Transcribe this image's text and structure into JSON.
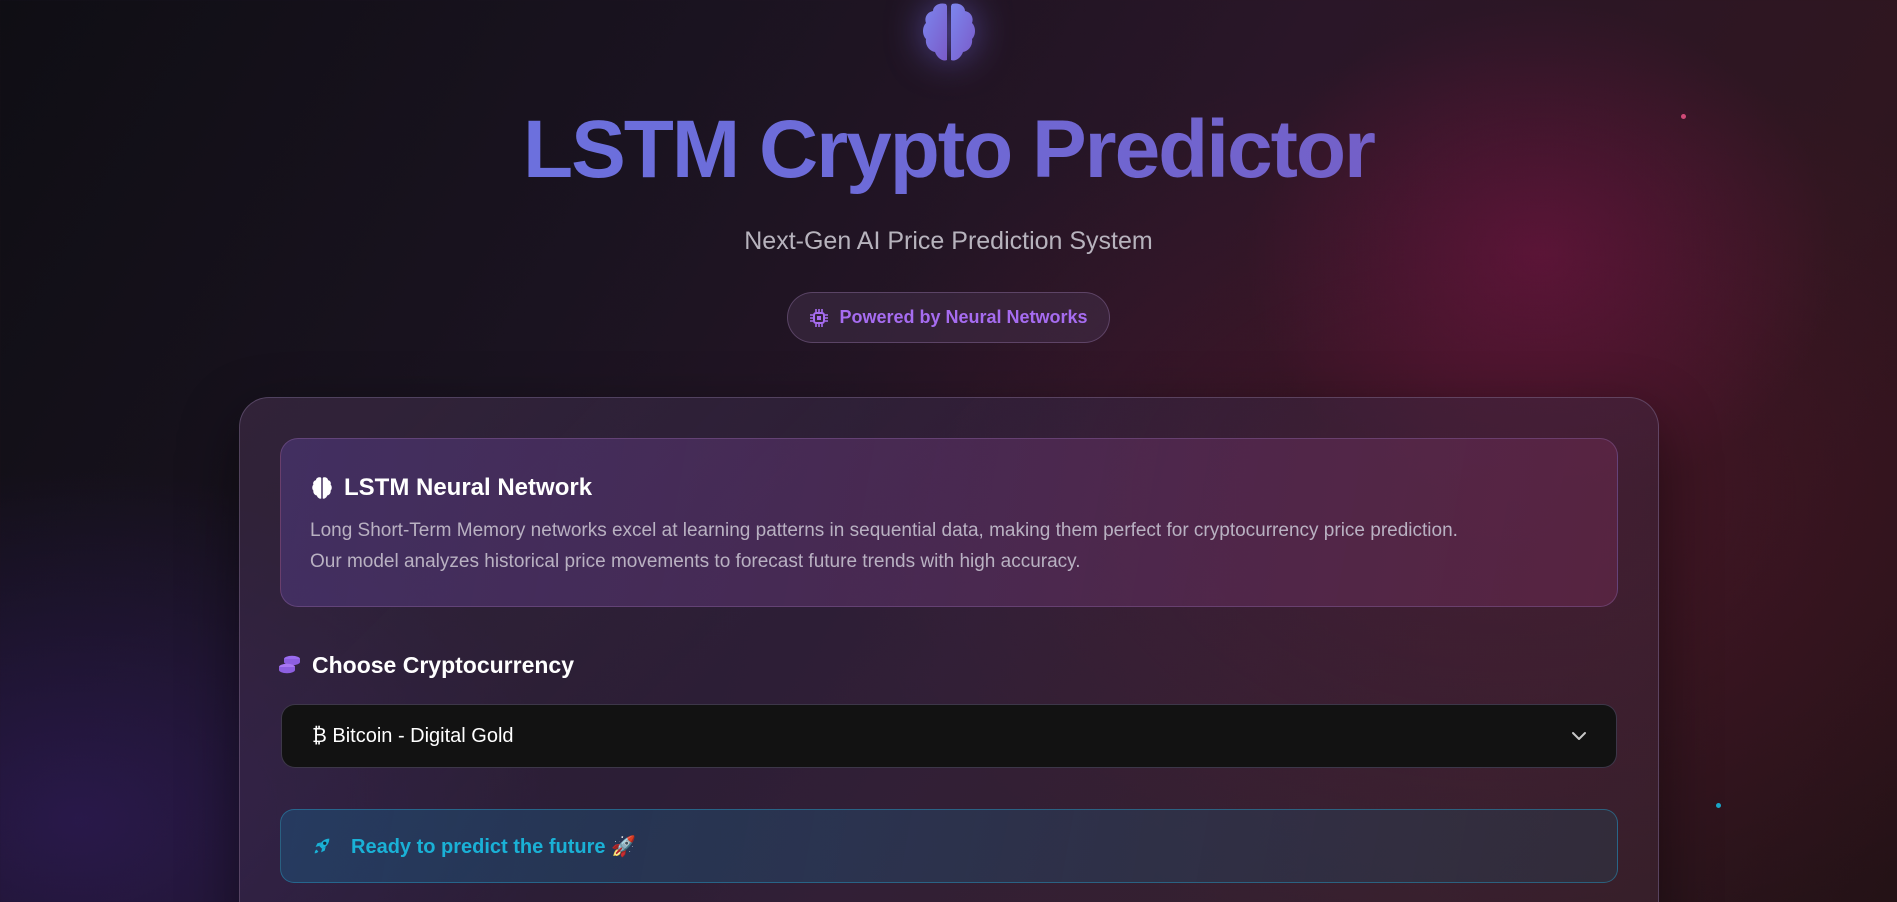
{
  "header": {
    "logo_icon": "brain-icon",
    "title": "LSTM Crypto Predictor",
    "subtitle": "Next-Gen AI Price Prediction System",
    "badge": {
      "icon": "chip-icon",
      "label": "Powered by Neural Networks"
    }
  },
  "info_card": {
    "icon": "brain-icon",
    "heading": "LSTM Neural Network",
    "description_line1": "Long Short-Term Memory networks excel at learning patterns in sequential data, making them perfect for cryptocurrency price prediction.",
    "description_line2": "Our model analyzes historical price movements to forecast future trends with high accuracy."
  },
  "crypto_select": {
    "icon": "coins-icon",
    "label": "Choose Cryptocurrency",
    "selected_value": "₿ Bitcoin - Digital Gold",
    "dropdown_icon": "chevron-down-icon"
  },
  "status": {
    "icon": "rocket-icon",
    "text": "Ready to predict the future 🚀"
  },
  "colors": {
    "accent_purple": "#a66cf0",
    "title_gradient_start": "#6a78e6",
    "title_gradient_end": "#7a55b8",
    "status_cyan": "#1ab1d6"
  }
}
